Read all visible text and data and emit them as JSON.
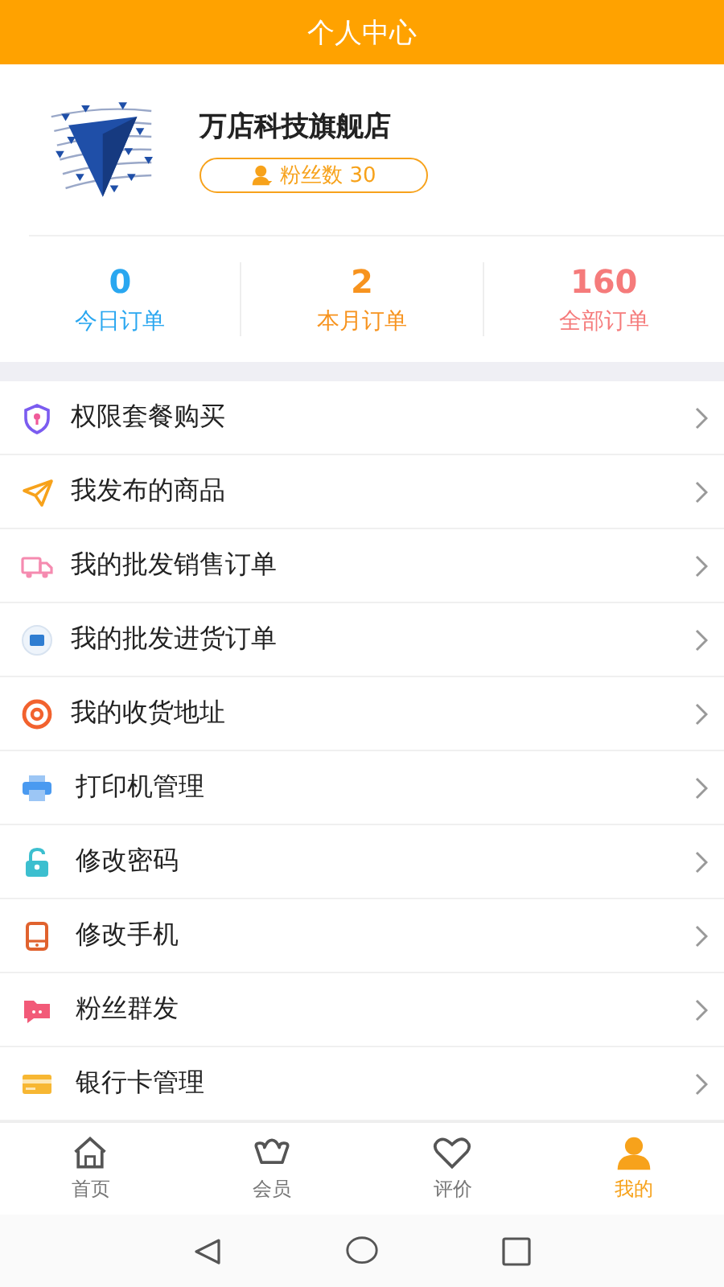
{
  "header": {
    "title": "个人中心"
  },
  "profile": {
    "name": "万店科技旗舰店",
    "fans_label": "粉丝数 30"
  },
  "stats": [
    {
      "value": "0",
      "label": "今日订单",
      "color": "#2aa7f0"
    },
    {
      "value": "2",
      "label": "本月订单",
      "color": "#f7931e"
    },
    {
      "value": "160",
      "label": "全部订单",
      "color": "#f57b7b"
    }
  ],
  "menu": [
    {
      "label": "权限套餐购买"
    },
    {
      "label": "我发布的商品"
    },
    {
      "label": "我的批发销售订单"
    },
    {
      "label": "我的批发进货订单"
    },
    {
      "label": "我的收货地址"
    },
    {
      "label": "打印机管理"
    },
    {
      "label": "修改密码"
    },
    {
      "label": "修改手机"
    },
    {
      "label": "粉丝群发"
    },
    {
      "label": "银行卡管理"
    }
  ],
  "tabbar": [
    {
      "label": "首页",
      "selected": false
    },
    {
      "label": "会员",
      "selected": false
    },
    {
      "label": "评价",
      "selected": false
    },
    {
      "label": "我的",
      "selected": true
    }
  ]
}
